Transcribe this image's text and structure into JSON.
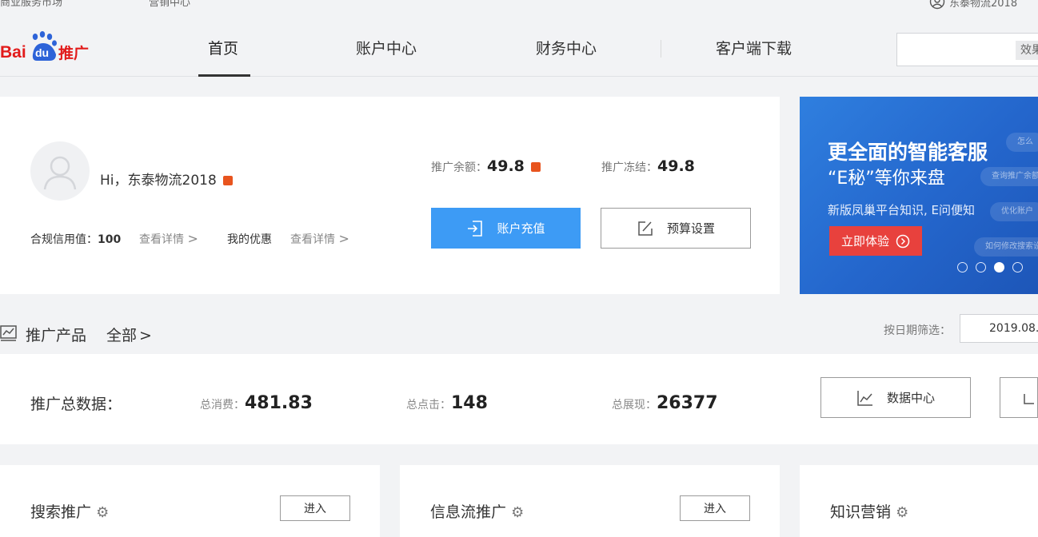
{
  "topbar": {
    "market_link": "商业服务市场",
    "marketing_link": "营销中心",
    "username": "东泰物流2018"
  },
  "logo": {
    "text_left": "Bai",
    "text_du": "du",
    "text_right": "推广"
  },
  "nav": {
    "items": [
      {
        "label": "首页",
        "active": true
      },
      {
        "label": "账户中心"
      },
      {
        "label": "财务中心"
      },
      {
        "label": "客户端下载"
      }
    ],
    "search_button": "效果"
  },
  "account": {
    "greeting": "Hi，东泰物流2018",
    "credit_label": "合规信用值：",
    "credit_value": "100",
    "credit_detail": "查看详情",
    "offers_label": "我的优惠",
    "offers_detail": "查看详情",
    "balance_label": "推广余额：",
    "balance_value": "49.8",
    "frozen_label": "推广冻结：",
    "frozen_value": "49.8",
    "recharge_button": "账户充值",
    "budget_button": "预算设置"
  },
  "banner": {
    "title": "更全面的智能客服",
    "subtitle": "“E秘”等你来盘",
    "desc": "新版凤巢平台知识, E问便知",
    "cta": "立即体验",
    "bubbles": [
      "怎么",
      "查询推广余额",
      "优化账户",
      "如何修改搜索设置"
    ],
    "active_dot": 3,
    "dot_count": 4
  },
  "products_section": {
    "title": "推广产品",
    "all_link": "全部",
    "date_label": "按日期筛选：",
    "date_value": "2019.08."
  },
  "totals": {
    "title": "推广总数据：",
    "spend_label": "总消费：",
    "spend_value": "481.83",
    "clicks_label": "总点击：",
    "clicks_value": "148",
    "impressions_label": "总展现：",
    "impressions_value": "26377",
    "data_center_button": "数据中心"
  },
  "cards": [
    {
      "title": "搜索推广",
      "enter": "进入"
    },
    {
      "title": "信息流推广",
      "enter": "进入"
    },
    {
      "title": "知识营销"
    }
  ],
  "colors": {
    "primary": "#3d9bf5",
    "accent_orange": "#e8541e",
    "banner_blue": "#2466cc",
    "cta_red": "#e8413d"
  }
}
